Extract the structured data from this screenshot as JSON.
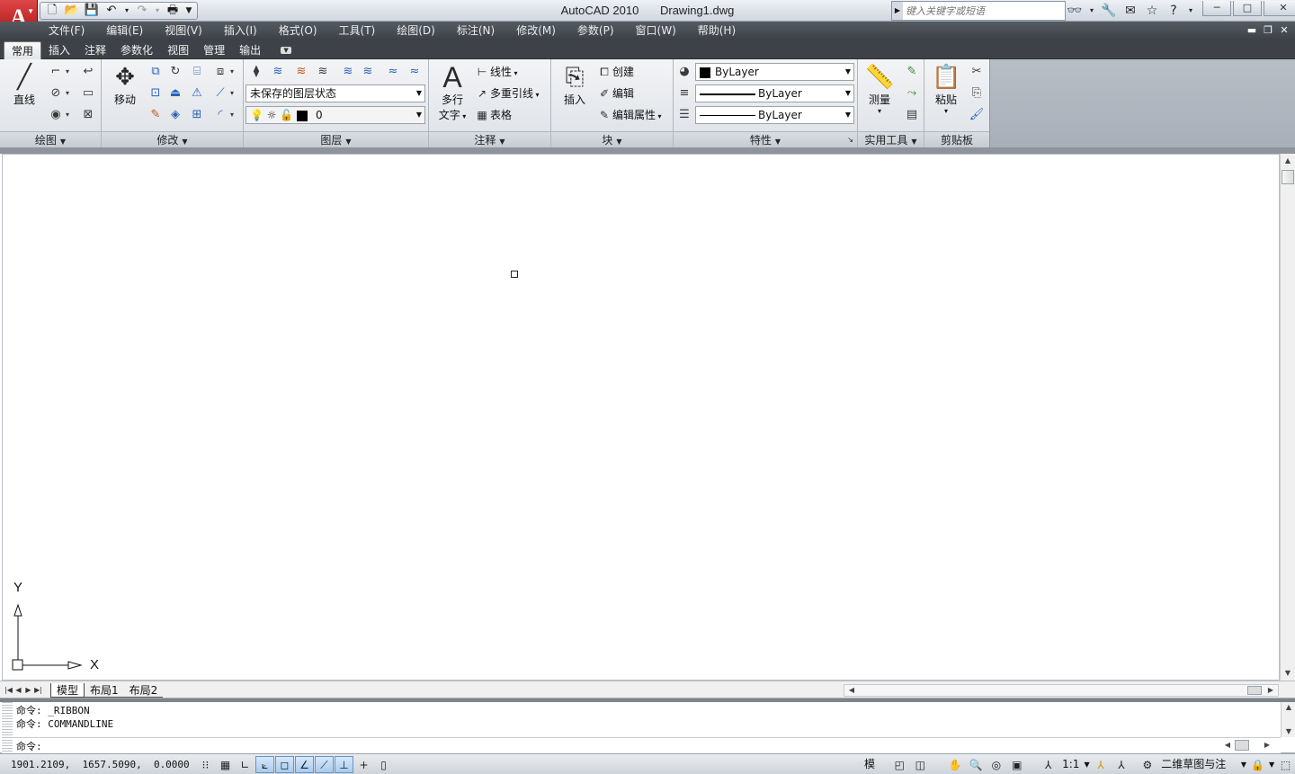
{
  "app": {
    "title": "AutoCAD 2010",
    "document": "Drawing1.dwg",
    "logo_letter": "A"
  },
  "quick_access": {
    "icons": [
      "new-icon",
      "open-icon",
      "save-icon",
      "undo-icon",
      "redo-icon",
      "plot-icon"
    ]
  },
  "search": {
    "placeholder": "键入关键字或短语"
  },
  "window_controls": {
    "minimize": "─",
    "maximize": "□",
    "close": "✕"
  },
  "menu": {
    "items": [
      "文件(F)",
      "编辑(E)",
      "视图(V)",
      "插入(I)",
      "格式(O)",
      "工具(T)",
      "绘图(D)",
      "标注(N)",
      "修改(M)",
      "参数(P)",
      "窗口(W)",
      "帮助(H)"
    ]
  },
  "ribbon_tabs": {
    "items": [
      "常用",
      "插入",
      "注释",
      "参数化",
      "视图",
      "管理",
      "输出"
    ],
    "active": "常用"
  },
  "ribbon": {
    "draw": {
      "title": "绘图",
      "line_label": "直线"
    },
    "modify": {
      "title": "修改",
      "move_label": "移动"
    },
    "layers": {
      "title": "图层",
      "state_value": "未保存的图层状态",
      "current_layer": "0"
    },
    "annotation": {
      "title": "注释",
      "mtext_label1": "多行",
      "mtext_label2": "文字",
      "linear": "线性",
      "mleader": "多重引线",
      "table": "表格"
    },
    "block": {
      "title": "块",
      "insert": "插入",
      "create": "创建",
      "edit": "编辑",
      "edit_attr": "编辑属性"
    },
    "properties": {
      "title": "特性",
      "color": "ByLayer",
      "lineweight": "ByLayer",
      "linetype": "ByLayer"
    },
    "utilities": {
      "title": "实用工具",
      "measure": "测量"
    },
    "clipboard": {
      "title": "剪贴板",
      "paste": "粘贴"
    }
  },
  "ucs": {
    "x_label": "X",
    "y_label": "Y"
  },
  "layout_tabs": {
    "items": [
      "模型",
      "布局1",
      "布局2"
    ],
    "active": "模型"
  },
  "command": {
    "history": [
      "命令: _RIBBON",
      "命令: COMMANDLINE"
    ],
    "prompt": "命令:"
  },
  "status": {
    "coordinates": "1901.2109,  1657.5090,  0.0000",
    "model_label": "模型",
    "annotation_scale": "1:1",
    "workspace": "二维草图与注释"
  }
}
